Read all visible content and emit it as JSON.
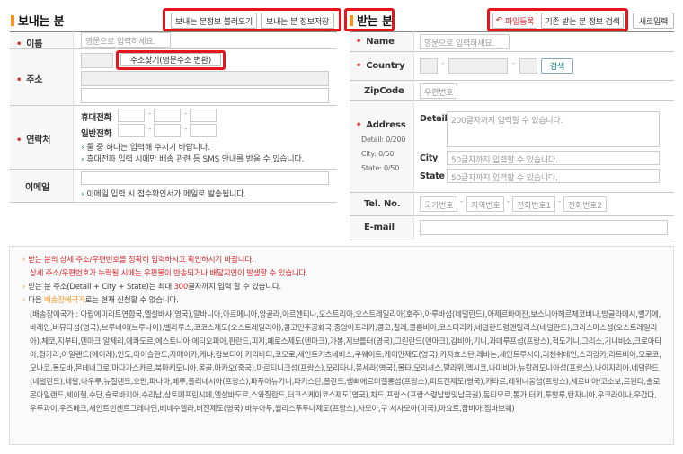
{
  "left": {
    "title": "보내는 분",
    "buttons": {
      "load": "보내는 분정보 불러오기",
      "save": "보내는 분 정보저장"
    },
    "name": {
      "label": "이름",
      "placeholder": "영문으로 입력하세요."
    },
    "address": {
      "label": "주소",
      "search_button": "주소찾기(영문주소 변환)"
    },
    "contact": {
      "label": "연락처",
      "mobile_label": "휴대전화",
      "phone_label": "일반전화",
      "note1": "둘 중 하나는 입력해 주시기 바랍니다.",
      "note2": "휴대전화 입력 시에만 배송 관련 등 SMS 안내를 받을 수 있습니다."
    },
    "email": {
      "label": "이메일",
      "note": "이메일 입력 시 접수확인서가 메일로 발송됩니다."
    }
  },
  "right": {
    "title": "받는 분",
    "buttons": {
      "file": "파일등록",
      "search": "기존 받는 분 정보 검색",
      "new": "새로입력"
    },
    "name": {
      "label": "Name",
      "placeholder": "영문으로 입력하세요."
    },
    "country": {
      "label": "Country",
      "search": "검색"
    },
    "zipcode": {
      "label": "ZipCode",
      "placeholder": "우편번호"
    },
    "address": {
      "label": "Address",
      "detail_count": "Detail: 0/200",
      "city_count": "City: 0/50",
      "state_count": "State: 0/50",
      "detail_label": "Detail :",
      "detail_placeholder": "200글자까지 입력할 수 있습니다.",
      "city_label": "City",
      "city_placeholder": "50글자까지 입력할 수 있습니다.",
      "state_label": "State :",
      "state_placeholder": "50글자까지 입력할 수 있습니다."
    },
    "tel": {
      "label": "Tel. No.",
      "country_code": "국가번호",
      "area_code": "지역번호",
      "phone1": "전화번호1",
      "phone2": "전화번호2"
    },
    "email": {
      "label": "E-mail"
    }
  },
  "info": {
    "line1": "받는 분의 상세 주소/우편번호를 정확히 입력하시고 확인하시기 바랍니다.",
    "line2": "상세 주소/우편번호가 누락될 시에는 우편물이 반송되거나 배달지연이 발생할 수 있습니다.",
    "line3a": "받는 분 주소(Detail + City + State)는 최대 ",
    "line3b": "300",
    "line3c": "글자까지 입력 할 수 있습니다.",
    "line4a": "다음 ",
    "line4b": "배송장애국가",
    "line4c": "로는 현재 신청할 수 없습니다.",
    "countries": "(배송장애국가 : 아랍에미리트연합국,엘살바샤(영국),알바니아,아르메니아,앙골라,아르헨티나,오스트리아,오스트레일리아(호주),아루바섬(네덜란드),아제르바이잔,보스니아헤르체코비나,방글라데시,벨기에,바레인,버뮤다섬(영국),브루네이(브루나이),벨라루스,코코스제도(오스트레일리아),콩고민주공화국,중앙아프리카,콩고,칠레,콜롬비아,코스타리카,네덜란드령앤틸리스(네덜란드),크리스마스섬(오스트레일리아),체코,지부티,덴마크,알제리,에콰도르,에스토니아,에티오피아,핀란드,피지,페로스제도(덴마크),가봉,지브롤터(영국),그린란드(덴마크),감비아,기니,과데루프섬(프랑스),적도기니,그리스,기니비소,크로아티아,헝가리,아일랜드(에이레),인도,아이슬란드,자메이카,케냐,캄보디아,키리바티,코모로,세인트키츠네비스,쿠웨이트,케이만제도(영국),카자흐스탄,레바논,세인트루시아,리첸쉬테인,스리랑카,라트비아,모로코,모나코,몰도바,몬테네그로,마다가스카르,북마케도니아,몽골,마카오(중국),마르티니크섬(프랑스),모리타니,몽세라(영국),몰타,모리셔스,말라위,멕시코,나미비아,뉴칼레도니아섬(프랑스),나이지리아,네덜란드(네덜란드),네팔,나우루,뉴질랜드,오만,파나마,페루,폴리네시아(프랑스),파푸아뉴기니,파키스탄,폴란드,쌩삐에르미켈롱섬(프랑스),피트캔제도(영국),카타르,레위니옹섬(프랑스),세르비아/코소보,르완다,솔로몬아일랜드,세이첼,수단,슬로바키아,수리남,상토메프린시페,엘살바도르,스와질란드,터크스케이코스제도(영국),차드,프랑스(프랑스령남방및남극권),동티모르,통가,터키,투발루,탄자니아,우크라이나,우간다,우루과이,우즈베크,세인트빈센트그레나딘,베네수엘라,버진제도(영국),바누아투,월리스푸투나제도(프랑스),사모아,구 서사모아(미국),마요트,잠비아,짐바브웨)"
  }
}
